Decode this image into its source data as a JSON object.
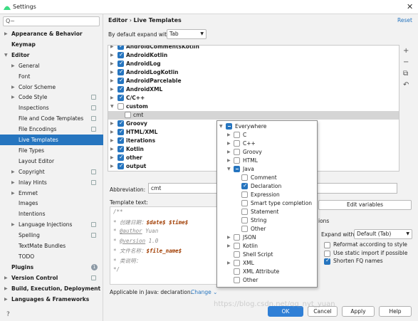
{
  "window": {
    "title": "Settings",
    "close_label": "✕"
  },
  "search": {
    "placeholder": "Q~",
    "icon": "search-icon"
  },
  "sidebar": {
    "items": [
      {
        "label": "Appearance & Behavior",
        "bold": true,
        "arrow": "▶"
      },
      {
        "label": "Keymap",
        "bold": true
      },
      {
        "label": "Editor",
        "bold": true,
        "arrow": "▼"
      },
      {
        "label": "General",
        "arrow": "▶"
      },
      {
        "label": "Font"
      },
      {
        "label": "Color Scheme",
        "arrow": "▶"
      },
      {
        "label": "Code Style",
        "arrow": "▶",
        "gear": true
      },
      {
        "label": "Inspections",
        "gear": true
      },
      {
        "label": "File and Code Templates",
        "gear": true
      },
      {
        "label": "File Encodings",
        "gear": true
      },
      {
        "label": "Live Templates",
        "selected": true
      },
      {
        "label": "File Types"
      },
      {
        "label": "Layout Editor"
      },
      {
        "label": "Copyright",
        "arrow": "▶",
        "gear": true
      },
      {
        "label": "Inlay Hints",
        "arrow": "▶",
        "gear": true
      },
      {
        "label": "Emmet",
        "arrow": "▶"
      },
      {
        "label": "Images"
      },
      {
        "label": "Intentions"
      },
      {
        "label": "Language Injections",
        "arrow": "▶",
        "gear": true
      },
      {
        "label": "Spelling",
        "gear": true
      },
      {
        "label": "TextMate Bundles"
      },
      {
        "label": "TODO"
      },
      {
        "label": "Plugins",
        "bold": true,
        "badge": "1"
      },
      {
        "label": "Version Control",
        "bold": true,
        "arrow": "▶",
        "gear": true
      },
      {
        "label": "Build, Execution, Deployment",
        "bold": true,
        "arrow": "▶"
      },
      {
        "label": "Languages & Frameworks",
        "bold": true,
        "arrow": "▶"
      }
    ]
  },
  "header": {
    "crumb_parent": "Editor",
    "crumb_sep": "›",
    "crumb_current": "Live Templates",
    "reset_label": "Reset"
  },
  "expand": {
    "label": "By default expand with",
    "value": "Tab"
  },
  "templates": [
    {
      "label": "AndroidCommentsKotlin",
      "state": "on",
      "arrow": "▶"
    },
    {
      "label": "AndroidKotlin",
      "state": "on",
      "arrow": "▶"
    },
    {
      "label": "AndroidLog",
      "state": "on",
      "arrow": "▶"
    },
    {
      "label": "AndroidLogKotlin",
      "state": "on",
      "arrow": "▶"
    },
    {
      "label": "AndroidParcelable",
      "state": "on",
      "arrow": "▶"
    },
    {
      "label": "AndroidXML",
      "state": "on",
      "arrow": "▶"
    },
    {
      "label": "C/C++",
      "state": "on",
      "arrow": "▶"
    },
    {
      "label": "custom",
      "state": "off",
      "arrow": "▼"
    },
    {
      "label": "cmt",
      "state": "off",
      "child": true,
      "selected": true
    },
    {
      "label": "Groovy",
      "state": "on",
      "arrow": "▶"
    },
    {
      "label": "HTML/XML",
      "state": "on",
      "arrow": "▶"
    },
    {
      "label": "iterations",
      "state": "on",
      "arrow": "▶"
    },
    {
      "label": "Kotlin",
      "state": "on",
      "arrow": "▶"
    },
    {
      "label": "other",
      "state": "on",
      "arrow": "▶"
    },
    {
      "label": "output",
      "state": "on",
      "arrow": "▶"
    }
  ],
  "side_buttons": [
    "+",
    "−",
    "⧉",
    "↶"
  ],
  "abbreviation": {
    "label": "Abbreviation:",
    "value": "cmt"
  },
  "template_text": {
    "label": "Template text:"
  },
  "editor_lines": [
    {
      "prefix": "/**",
      "var": "",
      "suffix": ""
    },
    {
      "prefix": " * 创建日期：",
      "var": "$date$ $time$",
      "suffix": ""
    },
    {
      "prefix": " * ",
      "tag": "@author",
      "suffix": " Yuan"
    },
    {
      "prefix": " * ",
      "tag": "@version",
      "suffix": " 1.0"
    },
    {
      "prefix": " * 文件名称：",
      "var": "$file_name$",
      "suffix": ""
    },
    {
      "prefix": " * 类说明：",
      "var": "",
      "suffix": ""
    },
    {
      "prefix": " */",
      "var": "",
      "suffix": ""
    }
  ],
  "applicable": {
    "text": "Applicable in Java: declaration.",
    "change_label": "Change",
    "change_arrow": "⌄"
  },
  "edit_variables_label": "Edit variables",
  "options": {
    "label": "ions",
    "expand_label": "Expand with",
    "expand_value": "Default (Tab)",
    "checks": [
      {
        "label": "Reformat according to style",
        "state": "off"
      },
      {
        "label": "Use static import if possible",
        "state": "off"
      },
      {
        "label": "Shorten FQ names",
        "state": "on"
      }
    ]
  },
  "context_popup": {
    "items": [
      {
        "label": "Everywhere",
        "state": "part",
        "arrow": "▼",
        "level": 0
      },
      {
        "label": "C",
        "state": "off",
        "arrow": "▶",
        "level": 1
      },
      {
        "label": "C++",
        "state": "off",
        "arrow": "▶",
        "level": 1
      },
      {
        "label": "Groovy",
        "state": "off",
        "arrow": "▶",
        "level": 1
      },
      {
        "label": "HTML",
        "state": "off",
        "arrow": "▶",
        "level": 1
      },
      {
        "label": "Java",
        "state": "part",
        "arrow": "▼",
        "level": 1
      },
      {
        "label": "Comment",
        "state": "off",
        "level": 2
      },
      {
        "label": "Declaration",
        "state": "on",
        "level": 2
      },
      {
        "label": "Expression",
        "state": "off",
        "level": 2
      },
      {
        "label": "Smart type completion",
        "state": "off",
        "level": 2
      },
      {
        "label": "Statement",
        "state": "off",
        "level": 2
      },
      {
        "label": "String",
        "state": "off",
        "level": 2
      },
      {
        "label": "Other",
        "state": "off",
        "level": 2
      },
      {
        "label": "JSON",
        "state": "off",
        "arrow": "▶",
        "level": 1
      },
      {
        "label": "Kotlin",
        "state": "off",
        "arrow": "▶",
        "level": 1
      },
      {
        "label": "Shell Script",
        "state": "off",
        "level": 1
      },
      {
        "label": "XML",
        "state": "off",
        "arrow": "▶",
        "level": 1
      },
      {
        "label": "XML Attribute",
        "state": "off",
        "level": 1
      },
      {
        "label": "Other",
        "state": "off",
        "level": 1
      }
    ]
  },
  "buttons": {
    "ok": "OK",
    "cancel": "Cancel",
    "apply": "Apply",
    "help": "Help"
  },
  "help_icon": "?",
  "watermark": "https://blog.csdn.net/qq_nyt_yuan",
  "colors": {
    "accent": "#2675bf",
    "selection": "#2675bf",
    "link": "#2675bf",
    "variable": "#a03c00"
  }
}
